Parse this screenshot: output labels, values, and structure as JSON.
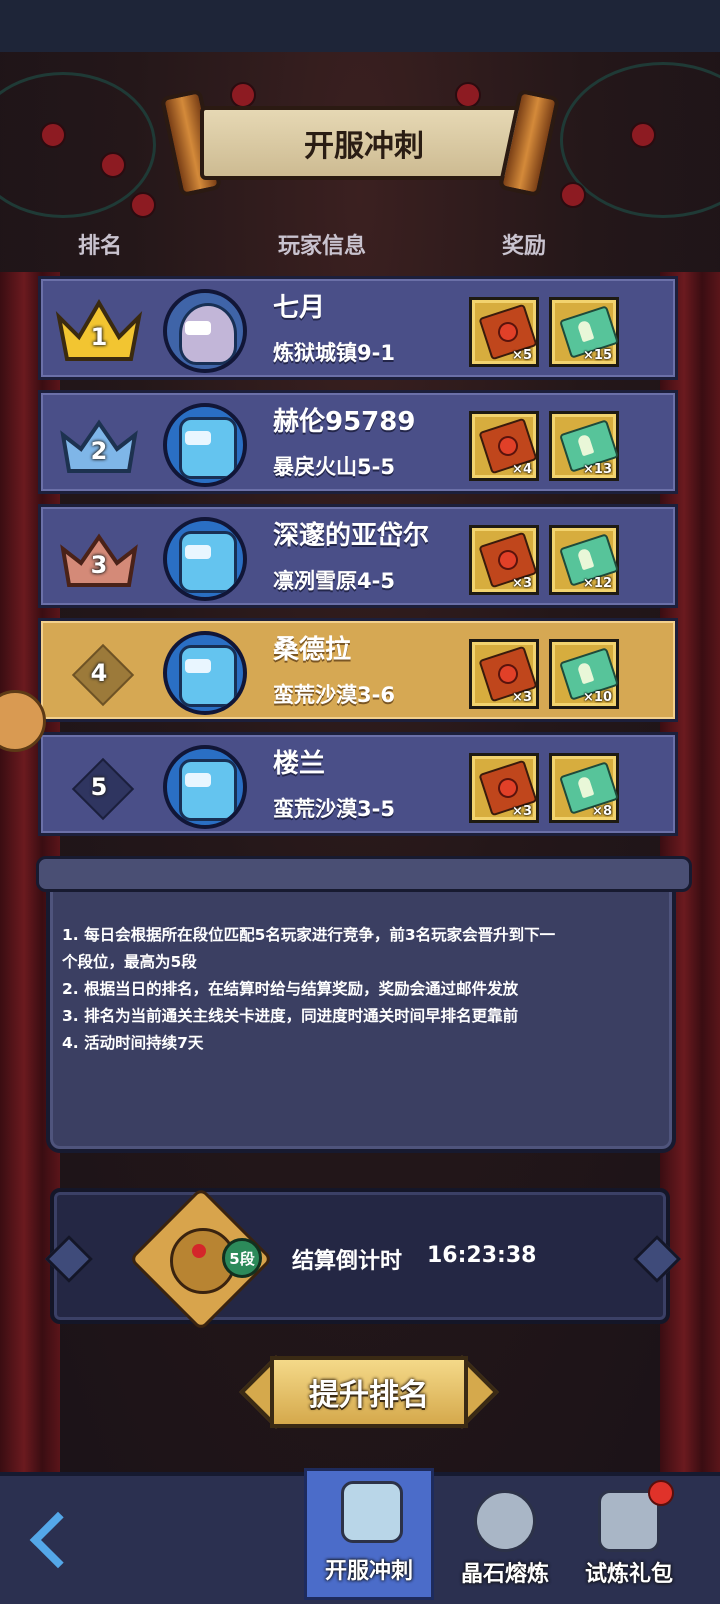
{
  "header": {
    "title": "开服冲刺"
  },
  "columns": {
    "rank": "排名",
    "player": "玩家信息",
    "reward": "奖励"
  },
  "rows": [
    {
      "rank": "1",
      "name": "七月",
      "stage": "炼狱城镇9-1",
      "reward1_count": "×5",
      "reward2_count": "×15",
      "highlight": false
    },
    {
      "rank": "2",
      "name": "赫伦95789",
      "stage": "暴戾火山5-5",
      "reward1_count": "×4",
      "reward2_count": "×13",
      "highlight": false
    },
    {
      "rank": "3",
      "name": "深邃的亚岱尔",
      "stage": "凛冽雪原4-5",
      "reward1_count": "×3",
      "reward2_count": "×12",
      "highlight": false
    },
    {
      "rank": "4",
      "name": "桑德拉",
      "stage": "蛮荒沙漠3-6",
      "reward1_count": "×3",
      "reward2_count": "×10",
      "highlight": true
    },
    {
      "rank": "5",
      "name": "楼兰",
      "stage": "蛮荒沙漠3-5",
      "reward1_count": "×3",
      "reward2_count": "×8",
      "highlight": false
    }
  ],
  "rules": [
    "1. 每日会根据所在段位匹配5名玩家进行竞争，前3名玩家会晋升到下一",
    "个段位，最高为5段",
    "2. 根据当日的排名，在结算时给与结算奖励，奖励会通过邮件发放",
    "3. 排名为当前通关主线关卡进度，同进度时通关时间早排名更靠前",
    "4. 活动时间持续7天"
  ],
  "countdown": {
    "tier": "5段",
    "label": "结算倒计时",
    "time": "16:23:38"
  },
  "cta": {
    "label": "提升排名"
  },
  "nav": {
    "tabs": [
      {
        "label": "开服冲刺",
        "icon": "armor-icon",
        "active": true
      },
      {
        "label": "晶石熔炼",
        "icon": "crystal-furnace-icon",
        "active": false
      },
      {
        "label": "试炼礼包",
        "icon": "gift-pack-icon",
        "active": false
      }
    ]
  },
  "colors": {
    "row": "#4a4f88",
    "row_highlight": "#d6a853",
    "gold": "#d7ad3e",
    "crown_gold": "#f2c531",
    "crown_silver": "#7fb6e8",
    "crown_bronze": "#d48a78"
  }
}
